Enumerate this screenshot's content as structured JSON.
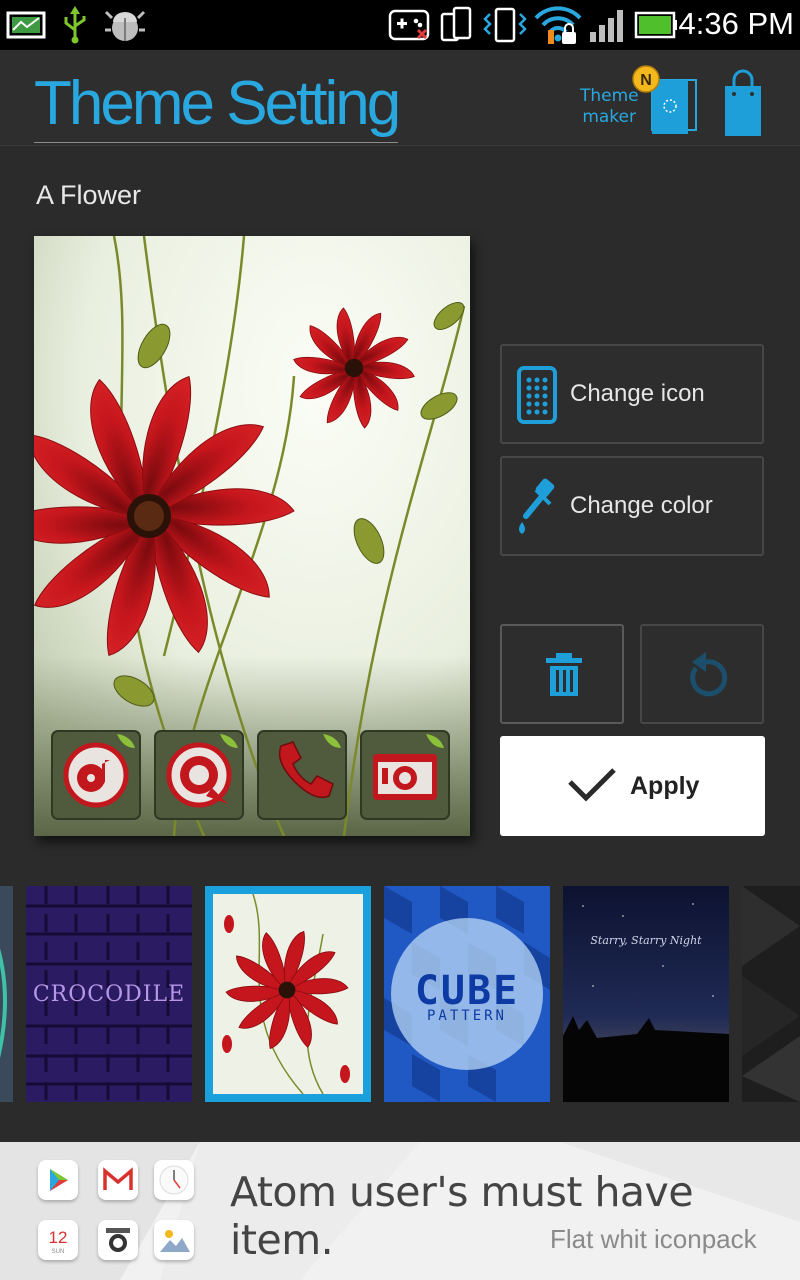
{
  "status_bar": {
    "time": "4:36 PM"
  },
  "header": {
    "title": "Theme Setting",
    "theme_maker_line1": "Theme",
    "theme_maker_line2": "maker",
    "new_badge": "N"
  },
  "theme": {
    "name": "A Flower"
  },
  "actions": {
    "change_icon_label": "Change icon",
    "change_color_label": "Change color",
    "apply_label": "Apply"
  },
  "carousel": {
    "items": [
      {
        "label": "CROCODILE"
      },
      {
        "label": ""
      },
      {
        "label": "CUBE",
        "sublabel": "PATTERN"
      },
      {
        "label": "Starry, Starry Night"
      }
    ],
    "selected_index": 1
  },
  "ad": {
    "headline": "Atom user's must have item.",
    "subline": "Flat whit iconpack",
    "calendar_day": "12",
    "calendar_weekday": "SUN"
  },
  "colors": {
    "accent": "#29a8e0",
    "background": "#2b2b2b",
    "flower_red": "#c0141a"
  }
}
